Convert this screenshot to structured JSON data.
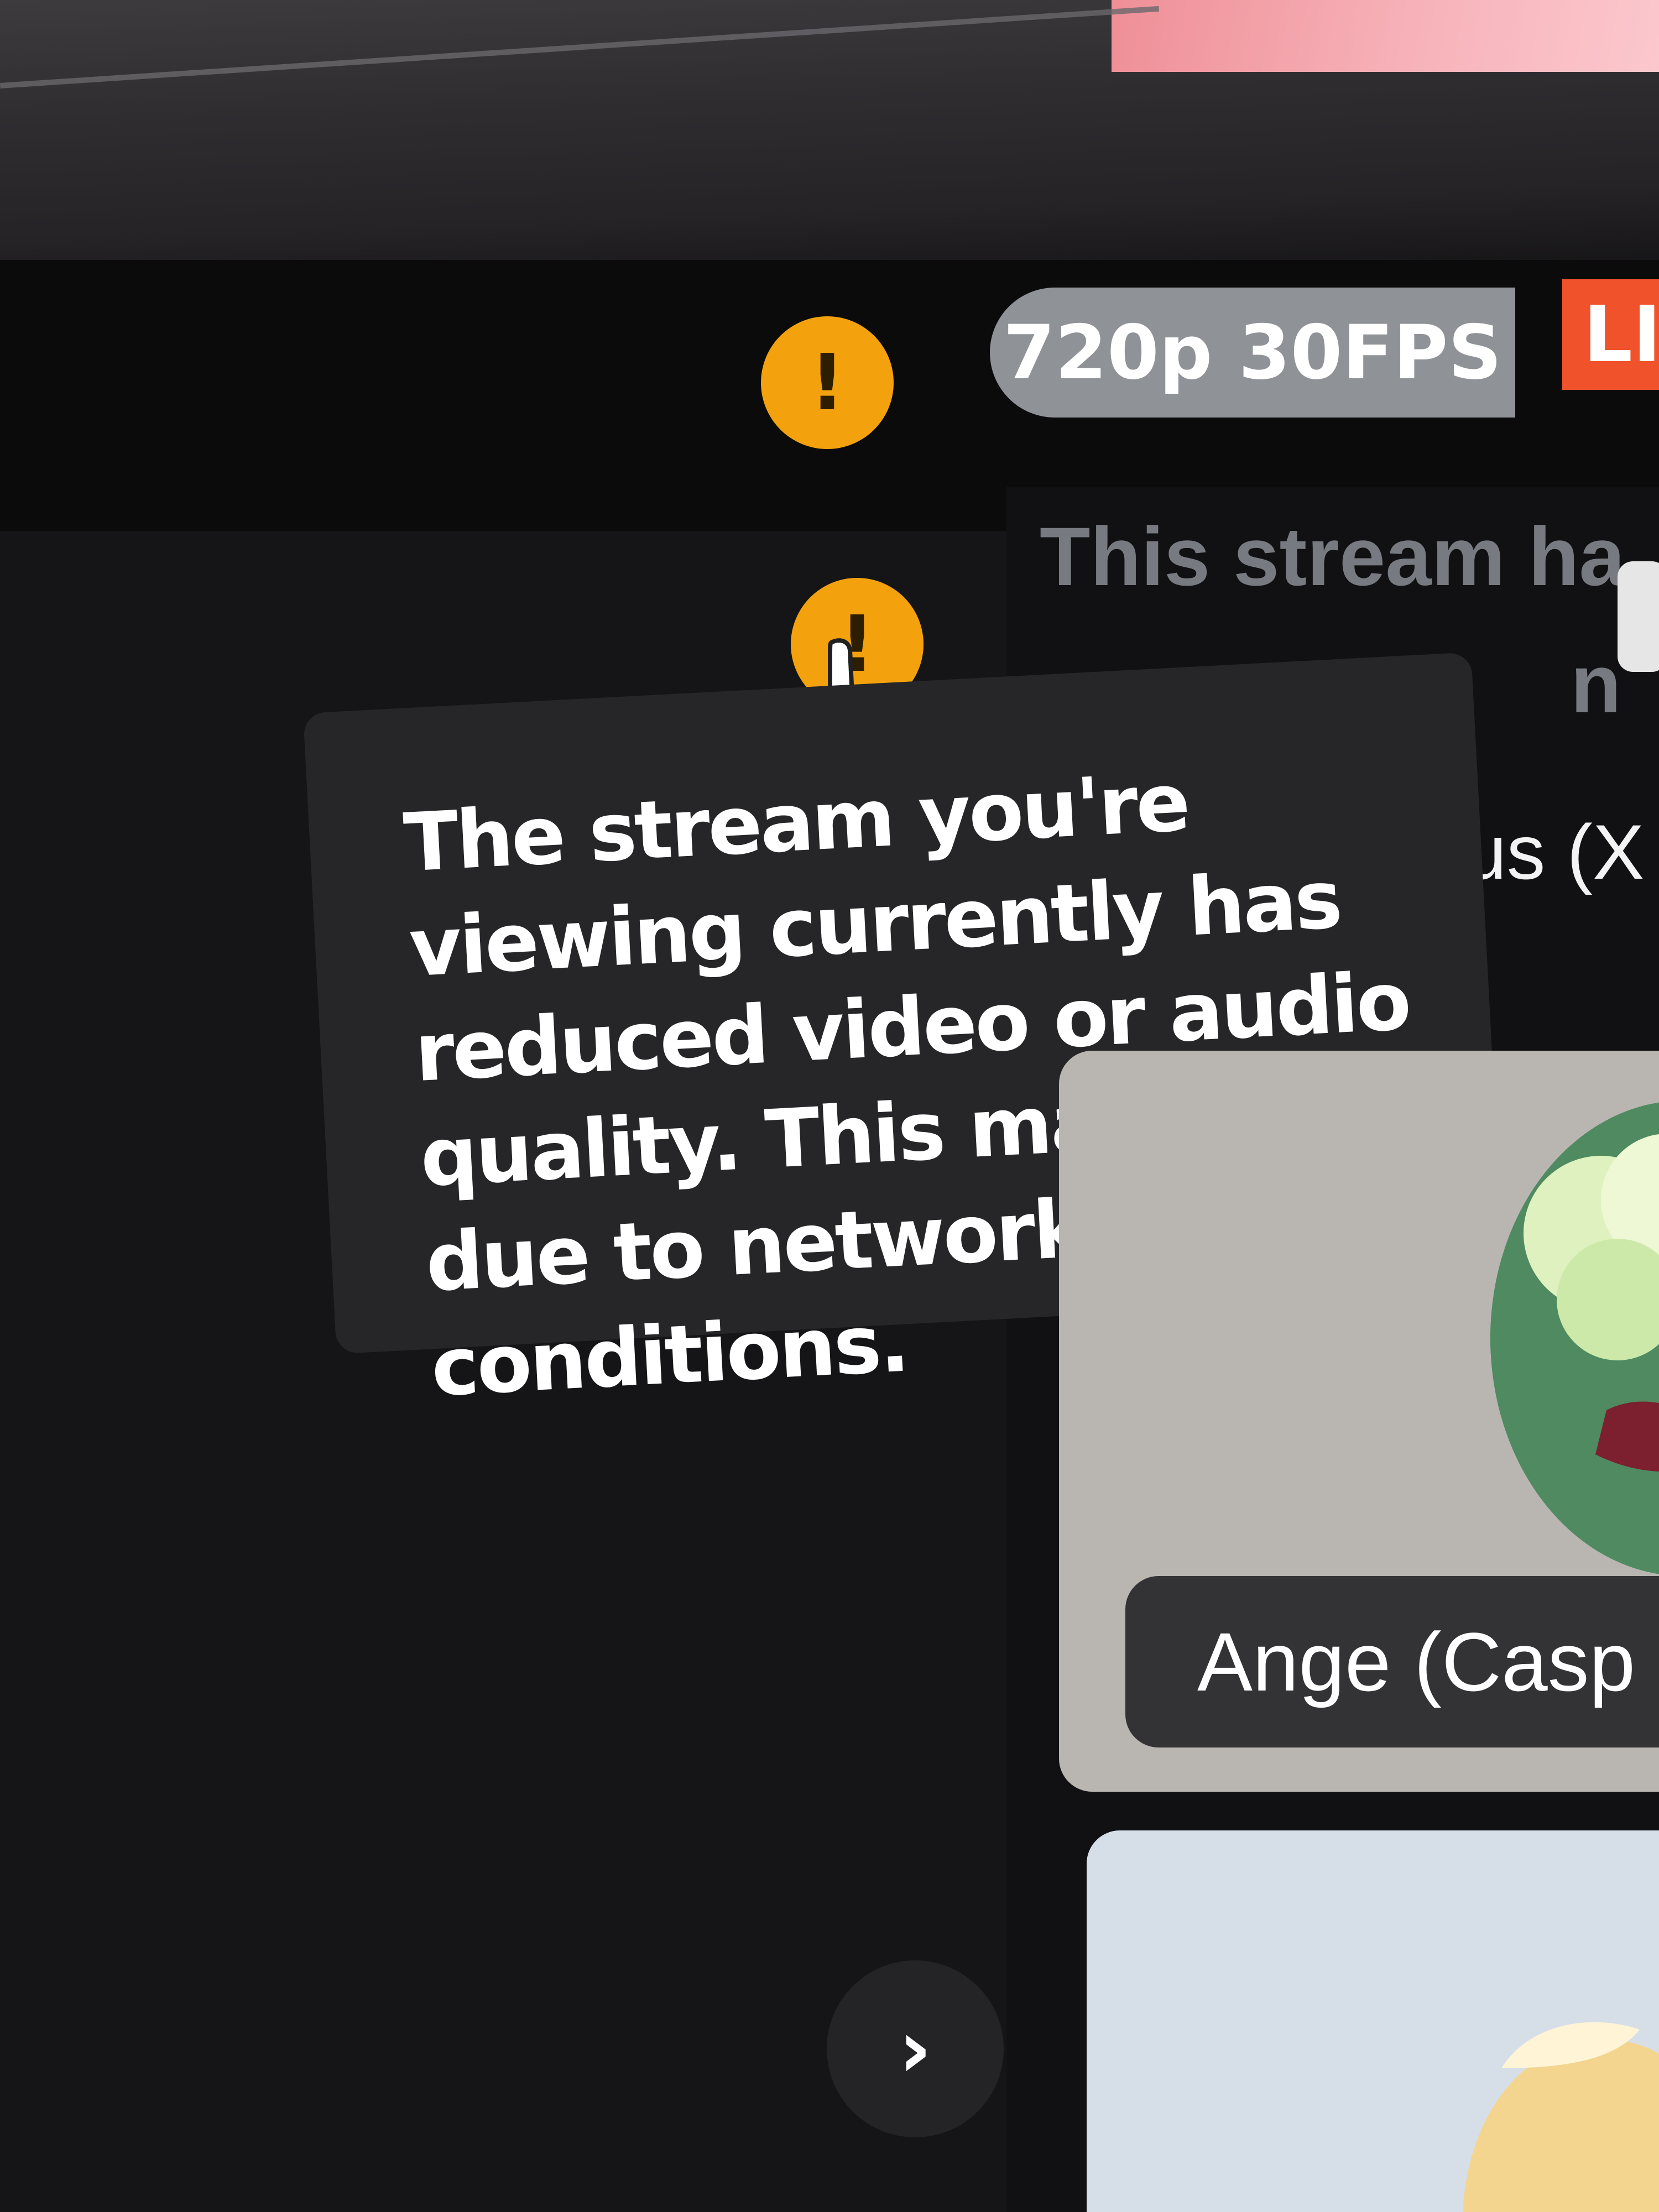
{
  "status": {
    "quality_badge": "720p 30FPS",
    "live_badge_fragment": "LI"
  },
  "tooltip": {
    "text": "The stream you're viewing currently has reduced video or audio quality. This may be due to network conditions."
  },
  "background": {
    "notice_fragment_1": "This stream ha",
    "notice_fragment_2": "n",
    "participant_name_fragment": "rus (X",
    "card_name_fragment": "Ange (Casp"
  },
  "icons": {
    "warning_icon": "!",
    "next_icon": "›"
  },
  "colors": {
    "warning": "#f3a20d",
    "live": "#f0522b",
    "tooltip_bg": "#262628"
  }
}
